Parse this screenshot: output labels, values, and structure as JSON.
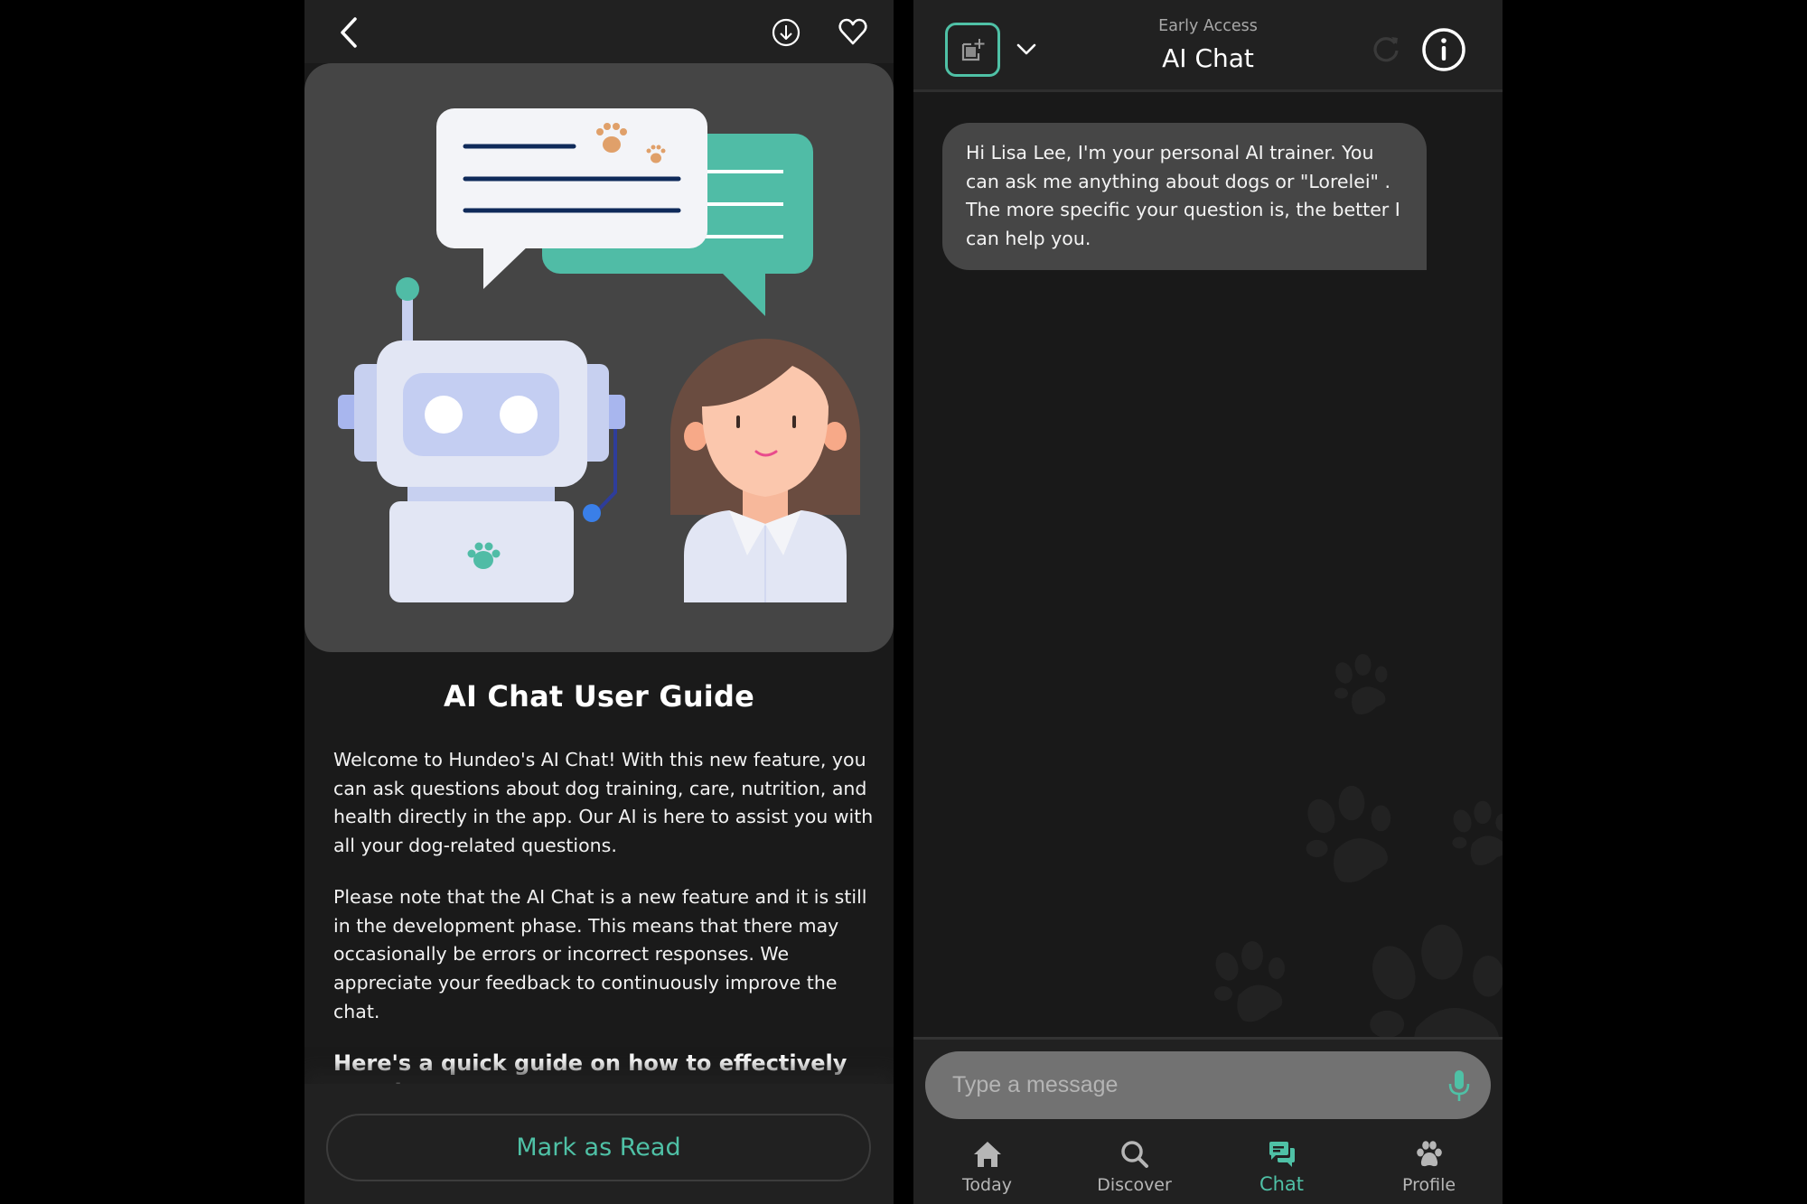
{
  "colors": {
    "accent": "#4fc1a6",
    "panel_bg": "#1a1a1a",
    "topbar_bg": "#212121",
    "card_bg": "#454545",
    "bubble_bg": "#464646",
    "input_bg": "#727272"
  },
  "left_screen": {
    "topbar": {
      "back_icon": "chevron-left-icon",
      "download_icon": "download-circle-icon",
      "favorite_icon": "heart-icon"
    },
    "hero_illustration": "robot-and-woman-chat-illustration",
    "article": {
      "title": "AI Chat User Guide",
      "paragraphs": [
        "Welcome to Hundeo's AI Chat! With this new feature, you can ask questions about dog training, care, nutrition, and health directly in the app. Our AI is here to assist you with all your dog-related questions.",
        "Please note that the AI Chat is a new feature and it is still in the development phase. This means that there may occasionally be errors or incorrect responses. We appreciate your feedback to continuously improve the chat."
      ],
      "subheading": "Here's a quick guide on how to effectively use the"
    },
    "mark_read_label": "Mark as Read"
  },
  "right_screen": {
    "header": {
      "eyebrow": "Early Access",
      "title": "AI Chat",
      "new_chat_icon": "new-chat-icon",
      "dropdown_icon": "chevron-down-icon",
      "refresh_icon": "refresh-icon",
      "info_icon": "info-icon"
    },
    "messages": [
      {
        "sender": "bot",
        "text": "Hi Lisa Lee, I'm your personal AI trainer. You can ask me anything about dogs or \"Lorelei\" . The more specific your question is, the better I can help you."
      }
    ],
    "input": {
      "placeholder": "Type a message",
      "value": "",
      "mic_icon": "microphone-icon"
    },
    "nav": {
      "active": "Chat",
      "items": [
        {
          "label": "Today",
          "icon": "home-icon"
        },
        {
          "label": "Discover",
          "icon": "search-icon"
        },
        {
          "label": "Chat",
          "icon": "chat-bubbles-icon"
        },
        {
          "label": "Profile",
          "icon": "paw-icon"
        }
      ]
    }
  }
}
